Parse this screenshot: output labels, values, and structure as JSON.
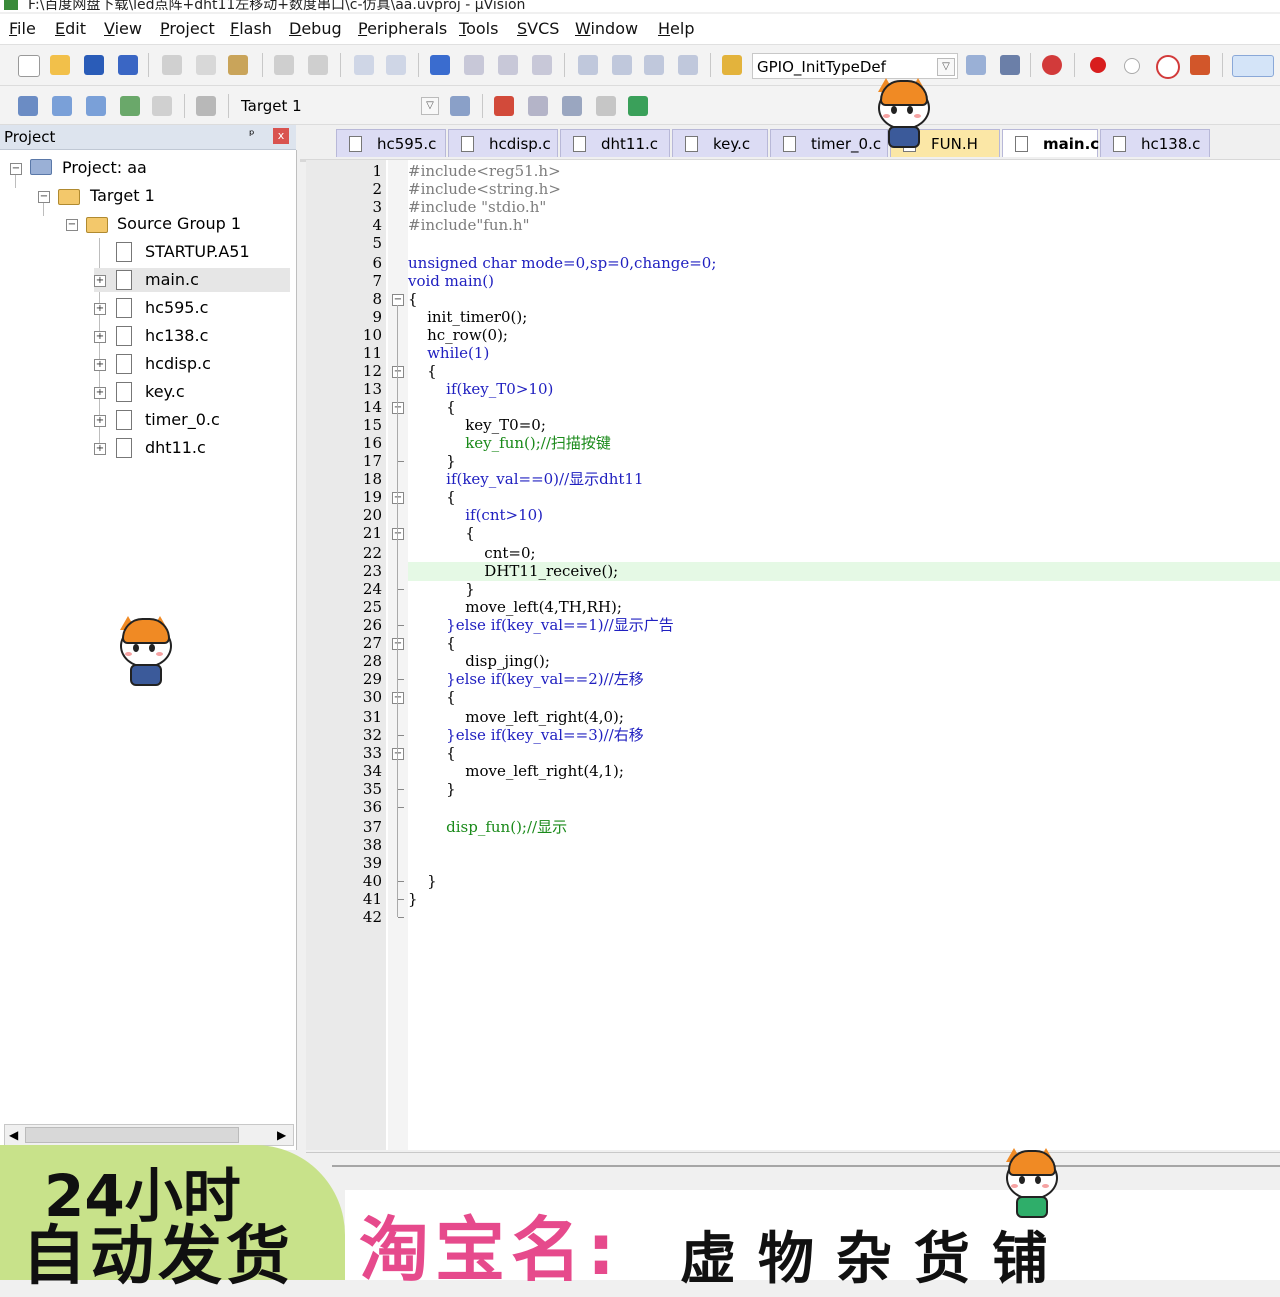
{
  "window": {
    "title": "F:\\百度网盘下载\\led点阵+dht11左移动+数度串口\\c-仿真\\aa.uvproj - µVision"
  },
  "menu": [
    "File",
    "Edit",
    "View",
    "Project",
    "Flash",
    "Debug",
    "Peripherals",
    "Tools",
    "SVCS",
    "Window",
    "Help"
  ],
  "toolbar": {
    "find_combo": "GPIO_InitTypeDef",
    "target_combo": "Target 1"
  },
  "project_panel": {
    "title": "Project",
    "pin_glyph": "ᵖ",
    "close_glyph": "x",
    "project": "Project: aa",
    "target": "Target 1",
    "group": "Source Group 1",
    "files": [
      "STARTUP.A51",
      "main.c",
      "hc595.c",
      "hc138.c",
      "hcdisp.c",
      "key.c",
      "timer_0.c",
      "dht11.c"
    ]
  },
  "tabs": [
    "hc595.c",
    "hcdisp.c",
    "dht11.c",
    "key.c",
    "timer_0.c",
    "FUN.H",
    "main.c",
    "hc138.c"
  ],
  "active_tab": "main.c",
  "editor": {
    "line_count": 42,
    "highlight_line": 23,
    "lines": [
      "#include<reg51.h>",
      "#include<string.h>",
      "#include \"stdio.h\"",
      "#include\"fun.h\"",
      "",
      "unsigned char mode=0,sp=0,change=0;",
      "void main()",
      "{",
      "    init_timer0();",
      "    hc_row(0);",
      "    while(1)",
      "    {",
      "        if(key_T0>10)",
      "        {",
      "            key_T0=0;",
      "            key_fun();//扫描按键",
      "        }",
      "        if(key_val==0)//显示dht11",
      "        {",
      "            if(cnt>10)",
      "            {",
      "                cnt=0;",
      "                DHT11_receive();",
      "            }",
      "            move_left(4,TH,RH);",
      "        }else if(key_val==1)//显示广告",
      "        {",
      "            disp_jing();",
      "        }else if(key_val==2)//左移",
      "        {",
      "            move_left_right(4,0);",
      "        }else if(key_val==3)//右移",
      "        {",
      "            move_left_right(4,1);",
      "        }",
      "",
      "        disp_fun();//显示",
      "",
      "",
      "    }",
      "}",
      ""
    ]
  },
  "banner": {
    "line1": "24小时",
    "line2": "自动发货",
    "shop_label": "淘宝名:",
    "shop_name": "虚物杂货铺"
  },
  "colors": {
    "keyword": "#2020c0",
    "comment": "#1a8a1a",
    "preprocessor": "#7d7d7d",
    "current_line": "#e5f9e5",
    "banner_green": "#c8e28a",
    "banner_pink": "#e64a8c"
  }
}
